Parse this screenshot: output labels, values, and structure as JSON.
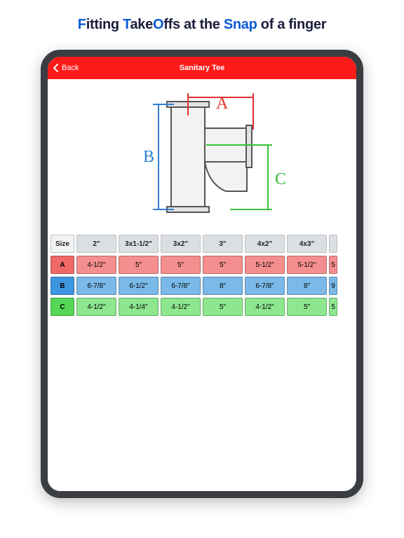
{
  "headline": {
    "p1a": "F",
    "p1b": "itting ",
    "p2a": "T",
    "p2b": "ake",
    "p3a": "O",
    "p3b": "ffs at the ",
    "p4": "Snap",
    "p5": " of a finger"
  },
  "nav": {
    "back": "Back",
    "title": "Sanitary Tee"
  },
  "diagram": {
    "A": "A",
    "B": "B",
    "C": "C"
  },
  "table": {
    "sizeLabel": "Size",
    "cols": [
      "2\"",
      "3x1-1/2\"",
      "3x2\"",
      "3\"",
      "4x2\"",
      "4x3\""
    ],
    "rows": {
      "A": {
        "label": "A",
        "cells": [
          "4-1/2\"",
          "5\"",
          "5\"",
          "5\"",
          "5-1/2\"",
          "5-1/2\""
        ],
        "partial": "5"
      },
      "B": {
        "label": "B",
        "cells": [
          "6-7/8\"",
          "6-1/2\"",
          "6-7/8\"",
          "8\"",
          "6-7/8\"",
          "8\""
        ],
        "partial": "9"
      },
      "C": {
        "label": "C",
        "cells": [
          "4-1/2\"",
          "4-1/4\"",
          "4-1/2\"",
          "5\"",
          "4-1/2\"",
          "5\""
        ],
        "partial": "5"
      }
    }
  },
  "chart_data": {
    "type": "table",
    "title": "Sanitary Tee dimensions",
    "columns": [
      "2\"",
      "3x1-1/2\"",
      "3x2\"",
      "3\"",
      "4x2\"",
      "4x3\""
    ],
    "series": [
      {
        "name": "A",
        "values": [
          "4-1/2\"",
          "5\"",
          "5\"",
          "5\"",
          "5-1/2\"",
          "5-1/2\""
        ]
      },
      {
        "name": "B",
        "values": [
          "6-7/8\"",
          "6-1/2\"",
          "6-7/8\"",
          "8\"",
          "6-7/8\"",
          "8\""
        ]
      },
      {
        "name": "C",
        "values": [
          "4-1/2\"",
          "4-1/4\"",
          "4-1/2\"",
          "5\"",
          "4-1/2\"",
          "5\""
        ]
      }
    ]
  }
}
